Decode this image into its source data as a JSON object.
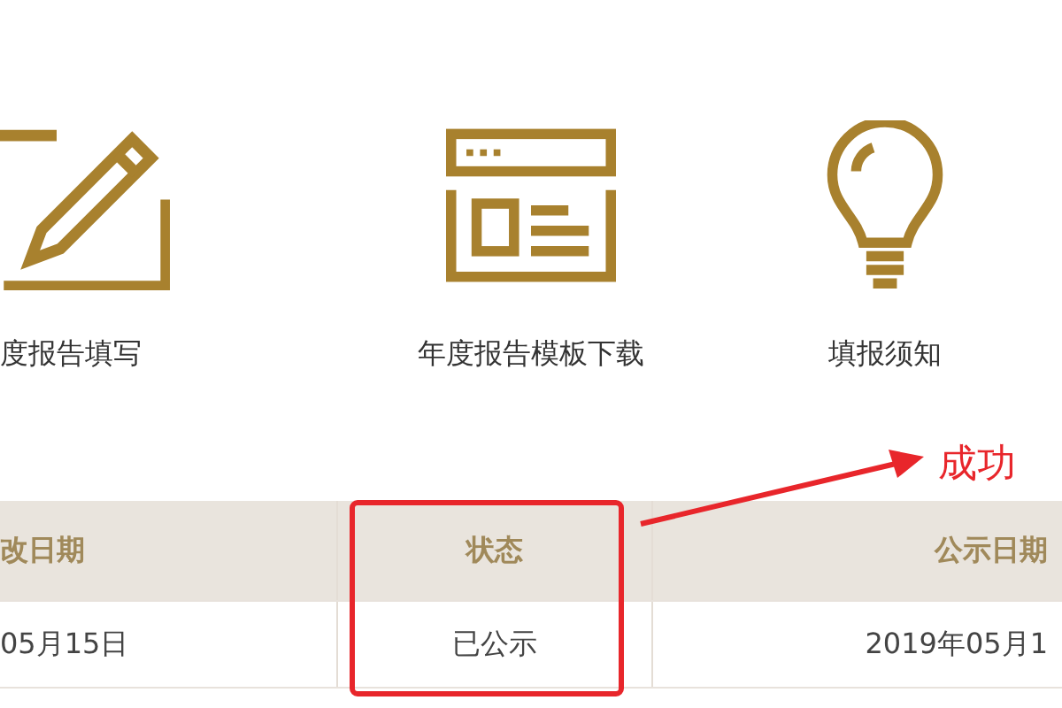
{
  "shortcuts": [
    {
      "kind": "edit",
      "label": "度报告填写"
    },
    {
      "kind": "template",
      "label": "年度报告模板下载"
    },
    {
      "kind": "tips",
      "label": "填报须知"
    }
  ],
  "table": {
    "columns": [
      "改日期",
      "状态",
      "公示日期"
    ],
    "rows": [
      [
        "05月15日",
        "已公示",
        "2019年05月1"
      ]
    ]
  },
  "annotation": {
    "label": "成功"
  }
}
